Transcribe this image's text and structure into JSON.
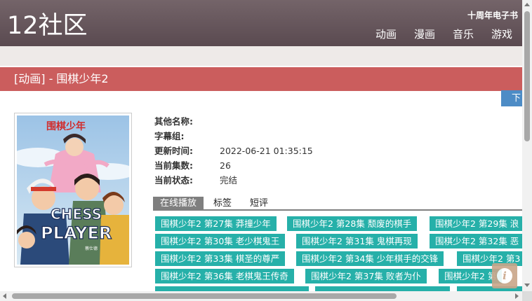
{
  "site": {
    "logo": "12社区",
    "anniversary": "十周年电子书",
    "nav": [
      "动画",
      "漫画",
      "音乐",
      "游戏"
    ]
  },
  "title_bar": "[动画] - 围棋少年2",
  "download_label": "下",
  "poster": {
    "title_cn": "围棋少年",
    "title_en_1": "CHESS",
    "title_en_2": "PLAYER",
    "credit": "蔡仕德"
  },
  "info": {
    "rows": [
      {
        "label": "其他名称:",
        "value": ""
      },
      {
        "label": "字幕组:",
        "value": ""
      },
      {
        "label": "更新时间:",
        "value": "2022-06-21 01:35:15"
      },
      {
        "label": "当前集数:",
        "value": "26"
      },
      {
        "label": "当前状态:",
        "value": "完结"
      }
    ]
  },
  "tabs": [
    "在线播放",
    "标签",
    "短评"
  ],
  "episodes": [
    [
      "围棋少年2 第27集 莽撞少年",
      "围棋少年2 第28集 颓废的棋手",
      "围棋少年2 第29集 浪"
    ],
    [
      "围棋少年2 第30集 老少棋鬼王",
      "围棋少年2 第31集 鬼棋再现",
      "围棋少年2 第32集 恶"
    ],
    [
      "围棋少年2 第33集 棋圣的尊严",
      "围棋少年2 第34集 少年棋手的交锋",
      "围棋少年2 第3"
    ],
    [
      "围棋少年2 第36集 老棋鬼王传奇",
      "围棋少年2 第37集 败者为仆",
      "围棋少年2 第"
    ],
    [
      "",
      "",
      ""
    ]
  ],
  "colors": {
    "header": "#5f5055",
    "title_bar": "#cb5d5d",
    "episode": "#26b0a9",
    "download": "#4d8cc6",
    "info_fab": "#c9a689"
  }
}
